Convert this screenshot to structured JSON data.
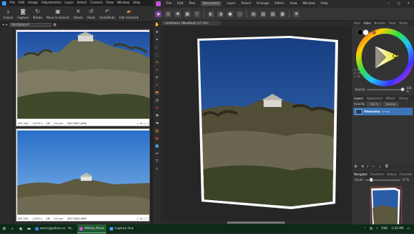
{
  "capture_one": {
    "menu": [
      "File",
      "Edit",
      "Image",
      "Adjustments",
      "Layer",
      "Select",
      "Camera",
      "View",
      "Window",
      "Help"
    ],
    "toolbar": [
      {
        "icon": "import-icon",
        "label": "Import"
      },
      {
        "icon": "capture-icon",
        "label": "Capture"
      },
      {
        "icon": "rotate-icon",
        "label": "Rotate"
      },
      {
        "icon": "move-to-selects-icon",
        "label": "Move to Selects"
      },
      {
        "icon": "delete-icon",
        "label": "Delete"
      },
      {
        "icon": "reset-icon",
        "label": "Reset"
      },
      {
        "icon": "undo-redo-icon",
        "label": "Undo/Redo"
      },
      {
        "icon": "edit-selected-icon",
        "label": "Edit Selected"
      }
    ],
    "path_field": "Background",
    "thumbnails": [
      {
        "iso": "ISO 100",
        "shutter": "1/125 s",
        "aperture": "f/8",
        "focal": "24 mm",
        "filename": "DSC7867.ARW",
        "stars": "○ ★ ○ ○"
      },
      {
        "iso": "ISO 100",
        "shutter": "1/250 s",
        "aperture": "f/8",
        "focal": "24 mm",
        "filename": "DSC7869.ARW",
        "stars": "○ ★ ○ ○"
      }
    ]
  },
  "affinity": {
    "menu": [
      "File",
      "Edit",
      "Text",
      "Document",
      "Layer",
      "Select",
      "Arrange",
      "Filters",
      "View",
      "Window",
      "Help"
    ],
    "active_menu": "Document",
    "window_controls": [
      "—",
      "□",
      "✕"
    ],
    "tab_title": "<Untitled> [Modified] (17.2%)",
    "panel_top_tabs": [
      "Hsm",
      "Color",
      "Brushes",
      "Swat",
      "Styles"
    ],
    "color_readout": [
      "H: 67",
      "S: 100",
      "L: 50"
    ],
    "opacity_label": "Opacity",
    "opacity_value": "100 %",
    "layers_tabs": [
      "Layers",
      "Adjustment",
      "Effects",
      "Library"
    ],
    "layer_opacity": "Opacity:",
    "layer_opacity_value": "100 %",
    "blend_mode": "Normal",
    "layer_name": "Panorama",
    "layer_kind": "(Pixel)",
    "nav_tabs": [
      "Navigator",
      "Transform",
      "History",
      "Channels"
    ],
    "zoom_label": "Zoom:",
    "zoom_value": "17 %",
    "colors": {
      "accent_layer": "#3b74b8",
      "brand": "#c454d8"
    }
  },
  "taskbar": {
    "apps": [
      {
        "label": "wecrc@yahoo.co - Yo...",
        "color": "#3b7bd8"
      },
      {
        "label": "Affinity Photo",
        "color": "#c454d8",
        "active": true
      },
      {
        "label": "Capture One",
        "color": "#3aa0ff"
      }
    ],
    "lang": "ENG",
    "time": "5:36 PM"
  }
}
